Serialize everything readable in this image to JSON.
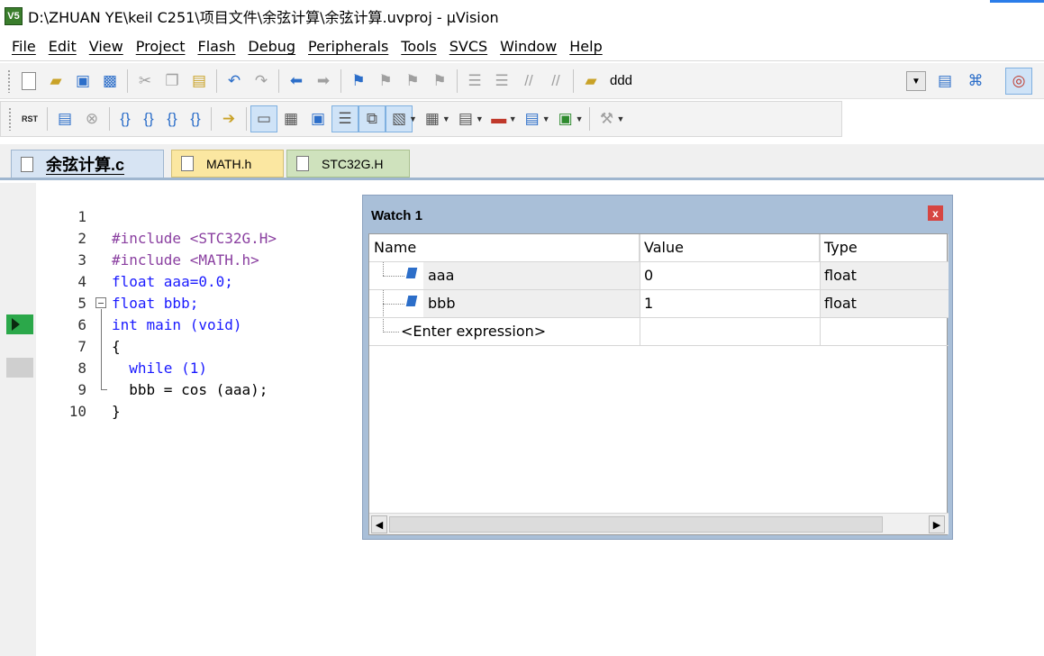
{
  "window": {
    "title": "D:\\ZHUAN YE\\keil C251\\项目文件\\余弦计算\\余弦计算.uvproj - µVision",
    "app_icon_text": "V5"
  },
  "menu": [
    "File",
    "Edit",
    "View",
    "Project",
    "Flash",
    "Debug",
    "Peripherals",
    "Tools",
    "SVCS",
    "Window",
    "Help"
  ],
  "toolbar": {
    "target_name": "ddd",
    "rst_label_top": "RST"
  },
  "tabs": [
    {
      "label": "余弦计算.c",
      "active": true,
      "color": "#d7e4f3"
    },
    {
      "label": "MATH.h",
      "active": false,
      "color": "#fbe7a1"
    },
    {
      "label": "STC32G.H",
      "active": false,
      "color": "#cfe2bd"
    }
  ],
  "editor": {
    "lines": [
      {
        "num": "1",
        "text": "#include <STC32G.H>"
      },
      {
        "num": "2",
        "text": "#include <MATH.h>"
      },
      {
        "num": "3",
        "text": "float aaa=0.0;"
      },
      {
        "num": "4",
        "text": "float bbb;"
      },
      {
        "num": "5",
        "text": "int main (void)"
      },
      {
        "num": "6",
        "text": "{"
      },
      {
        "num": "7",
        "text": "  while (1)"
      },
      {
        "num": "8",
        "text": "  bbb = cos (aaa);"
      },
      {
        "num": "9",
        "text": "}"
      },
      {
        "num": "10",
        "text": ""
      }
    ],
    "current_line": "7"
  },
  "watch": {
    "title": "Watch 1",
    "close": "x",
    "headers": {
      "name": "Name",
      "value": "Value",
      "type": "Type"
    },
    "rows": [
      {
        "name": "aaa",
        "value": "0",
        "type": "float"
      },
      {
        "name": "bbb",
        "value": "1",
        "type": "float"
      }
    ],
    "enter_expression": "<Enter expression>"
  },
  "colors": {
    "keyword": "#1a1aff",
    "preprocessor": "#8a3fa0",
    "watch_frame": "#a9bfd8",
    "run_marker": "#2ba84a"
  }
}
